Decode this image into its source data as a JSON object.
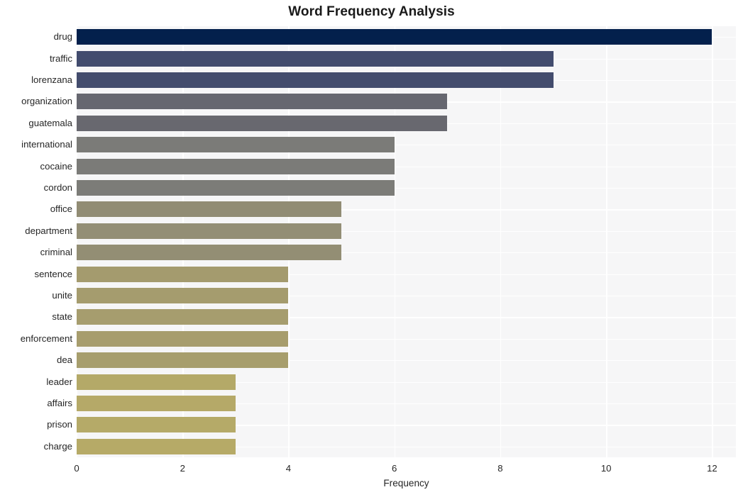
{
  "chart_data": {
    "type": "bar",
    "orientation": "horizontal",
    "title": "Word Frequency Analysis",
    "xlabel": "Frequency",
    "ylabel": "",
    "categories": [
      "drug",
      "traffic",
      "lorenzana",
      "organization",
      "guatemala",
      "international",
      "cocaine",
      "cordon",
      "office",
      "department",
      "criminal",
      "sentence",
      "unite",
      "state",
      "enforcement",
      "dea",
      "leader",
      "affairs",
      "prison",
      "charge"
    ],
    "values": [
      12,
      9,
      9,
      7,
      7,
      6,
      6,
      6,
      5,
      5,
      5,
      4,
      4,
      4,
      4,
      4,
      3,
      3,
      3,
      3
    ],
    "xlim": [
      0,
      12.45
    ],
    "xticks": [
      0,
      2,
      4,
      6,
      8,
      10,
      12
    ],
    "xticklabels": [
      "0",
      "2",
      "4",
      "6",
      "8",
      "10",
      "12"
    ],
    "grid": true,
    "grid_color": "#ffffff",
    "legend": null,
    "plot_background": "#f6f6f7",
    "figure_background": "#ffffff",
    "bar_colors": [
      "#03204c",
      "#424c6e",
      "#434c6d",
      "#666770",
      "#68686f",
      "#7b7b78",
      "#7b7b78",
      "#7c7c78",
      "#918c74",
      "#938e75",
      "#938e74",
      "#a49b6e",
      "#a59c6e",
      "#a69d6e",
      "#a79d6d",
      "#a79e6d",
      "#b4a968",
      "#b5a968",
      "#b5aa68",
      "#b6aa67"
    ]
  }
}
